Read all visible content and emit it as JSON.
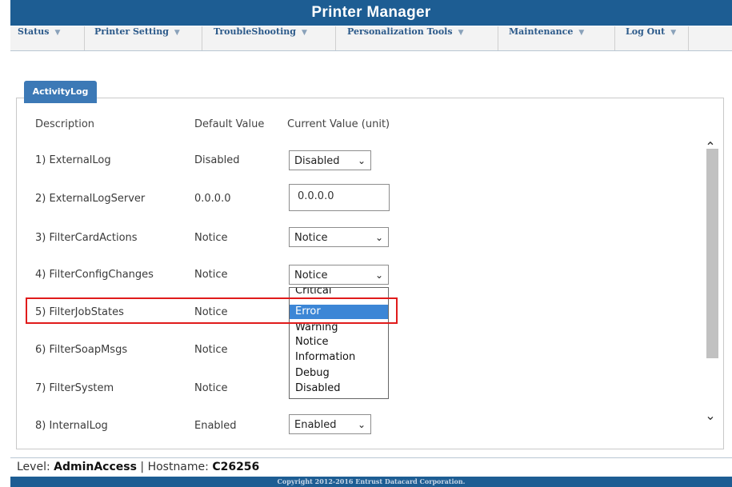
{
  "window": {
    "title": "Printer Manager"
  },
  "nav": [
    {
      "label": "Status"
    },
    {
      "label": "Printer Setting"
    },
    {
      "label": "TroubleShooting"
    },
    {
      "label": "Personalization Tools"
    },
    {
      "label": "Maintenance"
    },
    {
      "label": "Log Out"
    }
  ],
  "panel": {
    "tab_label": "ActivityLog",
    "headers": {
      "description": "Description",
      "default": "Default Value",
      "current": "Current Value (unit)"
    },
    "rows": [
      {
        "description": "1) ExternalLog",
        "default": "Disabled",
        "current": "Disabled"
      },
      {
        "description": "2) ExternalLogServer",
        "default": "0.0.0.0",
        "current": "0.0.0.0"
      },
      {
        "description": "3) FilterCardActions",
        "default": "Notice",
        "current": "Notice"
      },
      {
        "description": "4) FilterConfigChanges",
        "default": "Notice",
        "current": "Notice"
      },
      {
        "description": "5) FilterJobStates",
        "default": "Notice",
        "current": "Error"
      },
      {
        "description": "6) FilterSoapMsgs",
        "default": "Notice",
        "current": ""
      },
      {
        "description": "7) FilterSystem",
        "default": "Notice",
        "current": ""
      },
      {
        "description": "8) InternalLog",
        "default": "Enabled",
        "current": "Enabled"
      }
    ]
  },
  "dropdown": {
    "options": [
      "Critical",
      "Error",
      "Warning",
      "Notice",
      "Information",
      "Debug",
      "Disabled"
    ],
    "selected": "Error"
  },
  "status_bar": {
    "level_label": "Level:",
    "level_value": "AdminAccess",
    "separator": "|",
    "hostname_label": "Hostname:",
    "hostname_value": "C26256"
  },
  "footer": {
    "text": "Copyright 2012-2016 Entrust Datacard Corporation."
  },
  "colors": {
    "accent": "#1d5d93",
    "tab": "#3c79b6",
    "selected_option": "#3c86d6",
    "highlight": "#e01b1b"
  }
}
